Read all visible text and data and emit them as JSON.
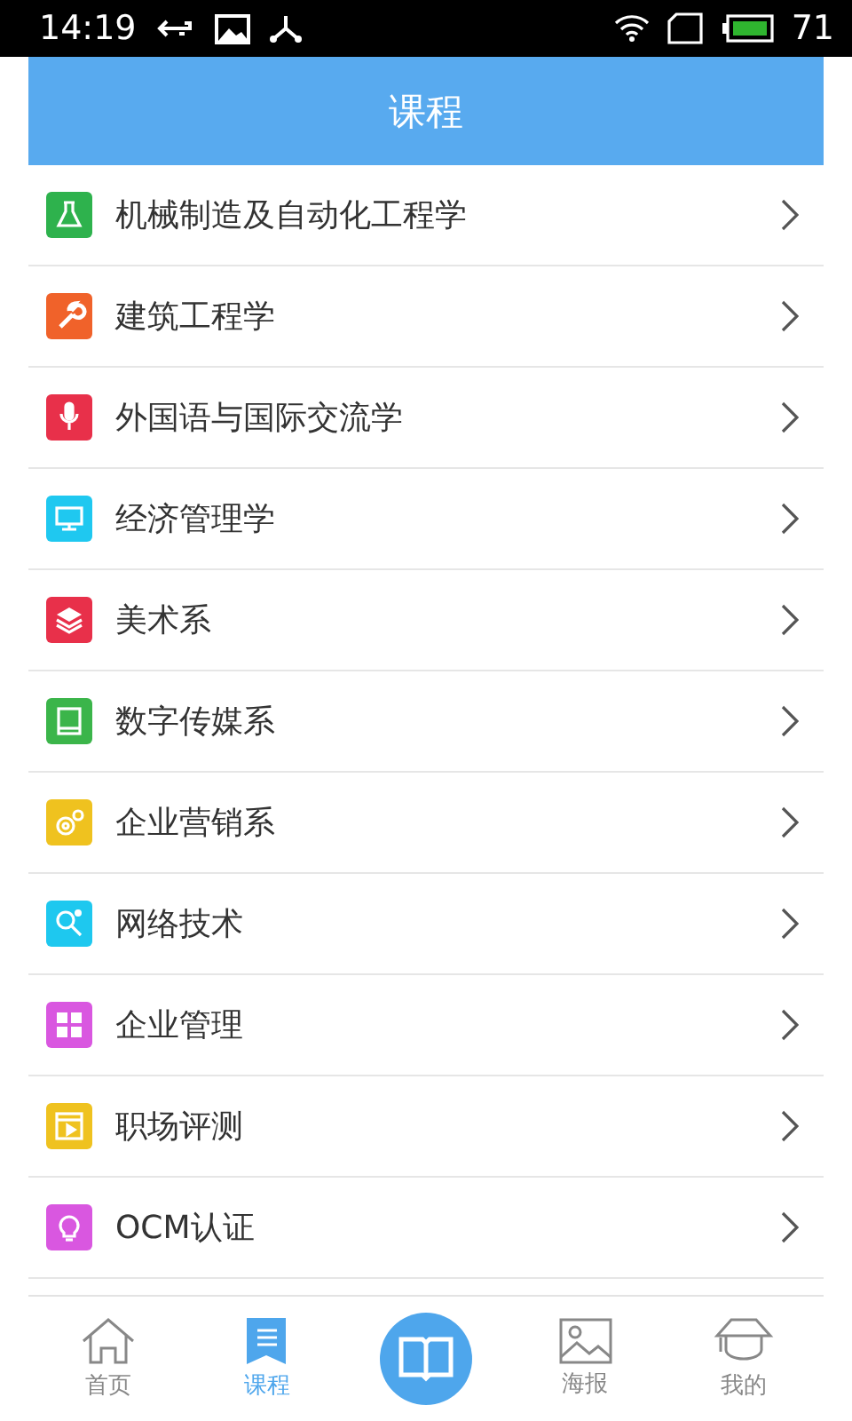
{
  "status_bar": {
    "time": "14:19",
    "battery": "71"
  },
  "header": {
    "title": "课程"
  },
  "courses": [
    {
      "label": "机械制造及自动化工程学",
      "color": "#2eb24d"
    },
    {
      "label": "建筑工程学",
      "color": "#f0622a"
    },
    {
      "label": "外国语与国际交流学",
      "color": "#e8304a"
    },
    {
      "label": "经济管理学",
      "color": "#1fc8f0"
    },
    {
      "label": "美术系",
      "color": "#e8304a"
    },
    {
      "label": "数字传媒系",
      "color": "#3bb54a"
    },
    {
      "label": "企业营销系",
      "color": "#efc21f"
    },
    {
      "label": "网络技术",
      "color": "#1ec8ef"
    },
    {
      "label": "企业管理",
      "color": "#d957e0"
    },
    {
      "label": "职场评测",
      "color": "#efc21f"
    },
    {
      "label": "OCM认证",
      "color": "#d957e0"
    }
  ],
  "nav": [
    {
      "kind": "tab",
      "label": "首页",
      "selected": false
    },
    {
      "kind": "tab",
      "label": "课程",
      "selected": true
    },
    {
      "kind": "center",
      "selected": false
    },
    {
      "kind": "tab",
      "label": "海报",
      "selected": false
    },
    {
      "kind": "tab",
      "label": "我的",
      "selected": false
    }
  ]
}
